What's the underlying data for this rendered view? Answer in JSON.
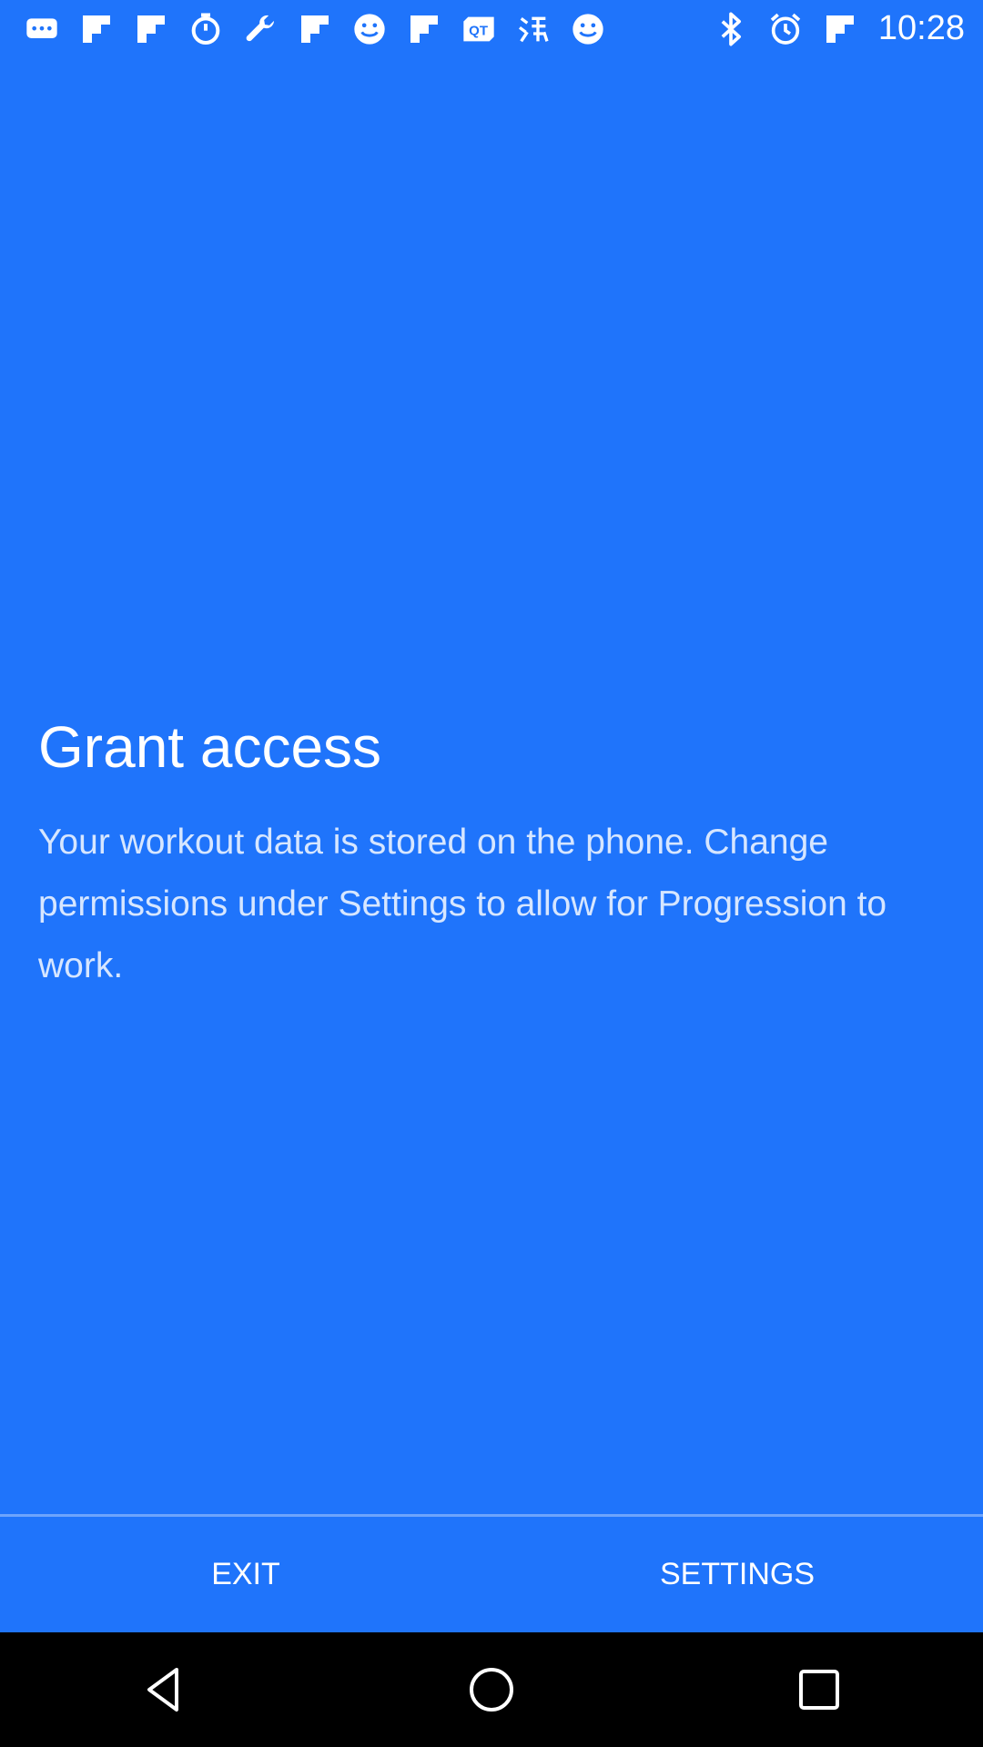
{
  "status_bar": {
    "left_icons": [
      "chat-bubble-icon",
      "flipboard-icon",
      "flipboard-icon",
      "timer-icon",
      "wrench-icon",
      "flipboard-icon",
      "smiley-icon",
      "flipboard-icon",
      "qt-icon",
      "kanji-icon",
      "smiley-icon"
    ],
    "right_icons": [
      "bluetooth-icon",
      "alarm-icon",
      "flipboard-icon"
    ],
    "time": "10:28"
  },
  "main": {
    "title": "Grant access",
    "message": "Your workout data is stored on the phone. Change permissions under Settings to allow for Progression to work."
  },
  "buttons": {
    "exit_label": "EXIT",
    "settings_label": "SETTINGS"
  },
  "nav_bar": {
    "icons": [
      "back-icon",
      "home-icon",
      "recents-icon"
    ]
  },
  "colors": {
    "background": "#1f74fb",
    "nav_bar": "#000000",
    "text": "#ffffff"
  }
}
